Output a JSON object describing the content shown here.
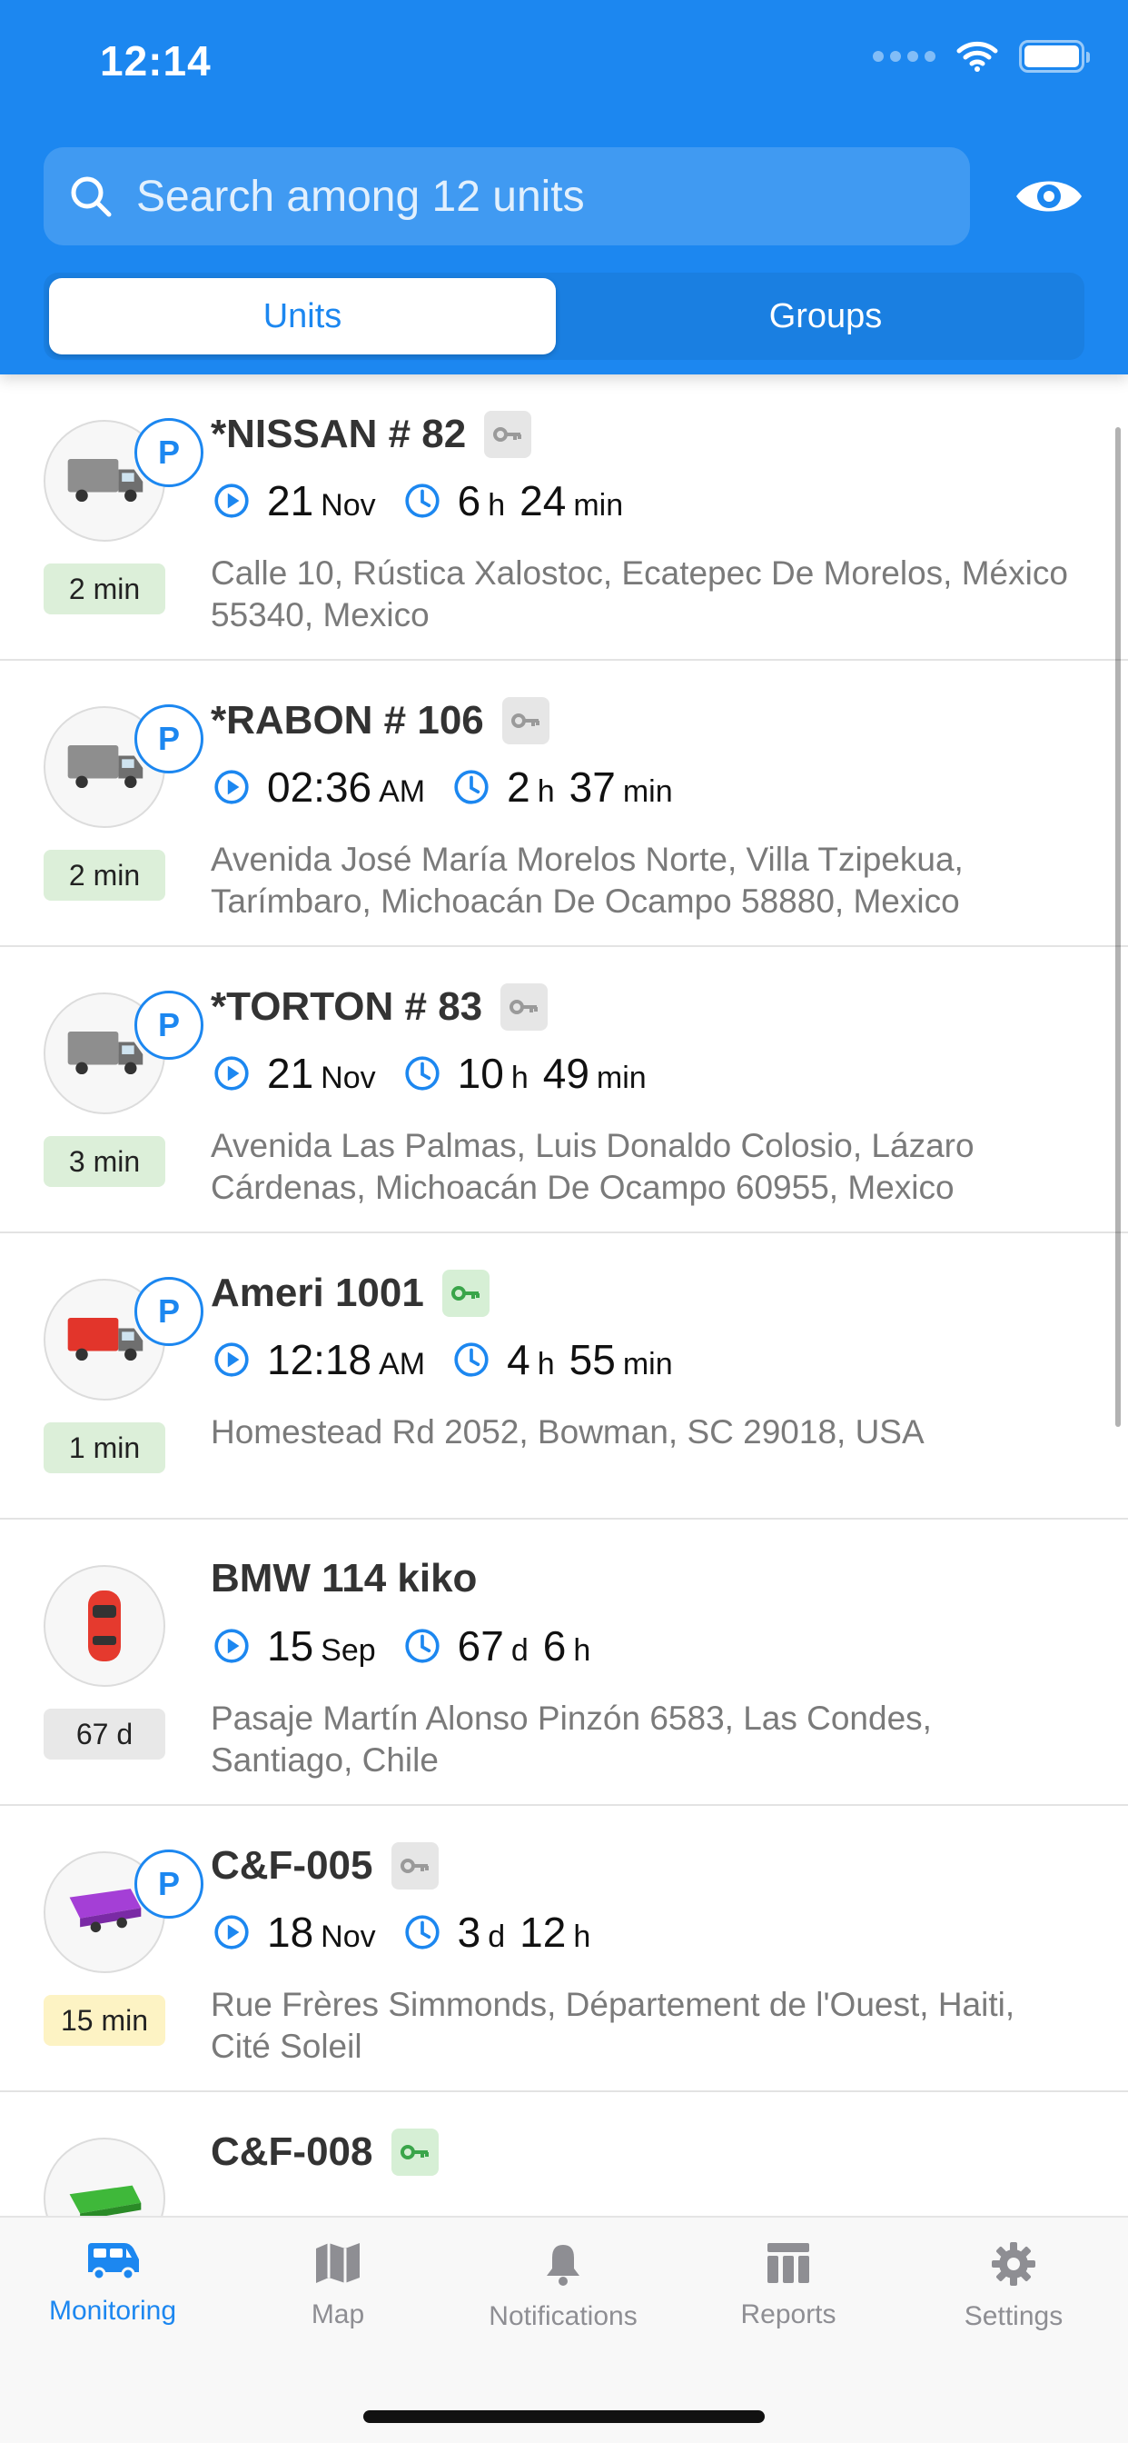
{
  "status_bar": {
    "time": "12:14"
  },
  "search": {
    "placeholder": "Search among 12 units"
  },
  "segments": {
    "units": "Units",
    "groups": "Groups"
  },
  "colors": {
    "accent": "#1c87f0",
    "age_green": "#dcefd9",
    "age_gray": "#e8e8e8",
    "age_yellow": "#fdf3c4",
    "key_green": "#3aa54a",
    "key_gray": "#9a9a9a"
  },
  "units": [
    {
      "name": "*NISSAN # 82",
      "parked": "P",
      "key": "gray",
      "icon": "truck-icon",
      "age": "2 min",
      "date_big": "21",
      "date_small": "Nov",
      "dur1_big": "6",
      "dur1_unit": "h",
      "dur2_big": "24",
      "dur2_unit": "min",
      "address": "Calle 10, Rústica Xalostoc, Ecatepec De Morelos, México 55340, Mexico"
    },
    {
      "name": "*RABON # 106",
      "parked": "P",
      "key": "gray",
      "icon": "box-truck-icon",
      "age": "2 min",
      "date_big": "02:36",
      "date_small": "AM",
      "dur1_big": "2",
      "dur1_unit": "h",
      "dur2_big": "37",
      "dur2_unit": "min",
      "address": "Avenida José María Morelos Norte, Villa Tzipekua, Tarímbaro, Michoacán De Ocampo 58880, Mexico"
    },
    {
      "name": "*TORTON # 83",
      "parked": "P",
      "key": "gray",
      "icon": "box-truck-icon",
      "age": "3 min",
      "date_big": "21",
      "date_small": "Nov",
      "dur1_big": "10",
      "dur1_unit": "h",
      "dur2_big": "49",
      "dur2_unit": "min",
      "address": "Avenida Las Palmas, Luis Donaldo Colosio, Lázaro Cárdenas, Michoacán De Ocampo 60955, Mexico"
    },
    {
      "name": "Ameri 1001",
      "parked": "P",
      "key": "green",
      "icon": "red-truck-icon",
      "age": "1 min",
      "date_big": "12:18",
      "date_small": "AM",
      "dur1_big": "4",
      "dur1_unit": "h",
      "dur2_big": "55",
      "dur2_unit": "min",
      "address": "Homestead Rd 2052, Bowman, SC 29018, USA"
    },
    {
      "name": "BMW 114 kiko",
      "parked": "",
      "key": "",
      "icon": "car-icon",
      "age": "67 d",
      "date_big": "15",
      "date_small": "Sep",
      "dur1_big": "67",
      "dur1_unit": "d",
      "dur2_big": "6",
      "dur2_unit": "h",
      "address": "Pasaje Martín Alonso Pinzón 6583, Las Condes, Santiago, Chile"
    },
    {
      "name": "C&F-005",
      "parked": "P",
      "key": "gray",
      "icon": "purple-trailer-icon",
      "age": "15 min",
      "date_big": "18",
      "date_small": "Nov",
      "dur1_big": "3",
      "dur1_unit": "d",
      "dur2_big": "12",
      "dur2_unit": "h",
      "address": "Rue Frères Simmonds, Département de l'Ouest, Haiti, Cité Soleil"
    },
    {
      "name": "C&F-008",
      "parked": "",
      "key": "green",
      "icon": "green-trailer-icon",
      "age": "",
      "date_big": "",
      "date_small": "",
      "dur1_big": "",
      "dur1_unit": "",
      "dur2_big": "",
      "dur2_unit": "",
      "address": ""
    }
  ],
  "tabbar": {
    "monitoring": "Monitoring",
    "map": "Map",
    "notifications": "Notifications",
    "reports": "Reports",
    "settings": "Settings"
  }
}
